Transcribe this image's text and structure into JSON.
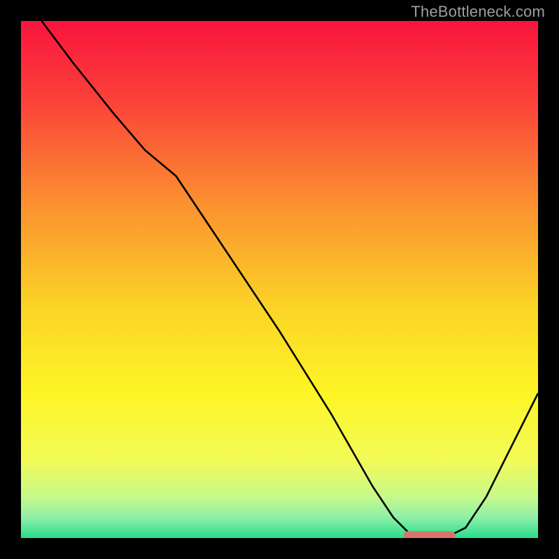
{
  "watermark": "TheBottleneck.com",
  "chart_data": {
    "type": "line",
    "title": "",
    "xlabel": "",
    "ylabel": "",
    "xlim": [
      0,
      100
    ],
    "ylim": [
      0,
      100
    ],
    "series": [
      {
        "name": "bottleneck-curve",
        "x": [
          4,
          10,
          18,
          24,
          30,
          40,
          50,
          60,
          68,
          72,
          75,
          78,
          82,
          86,
          90,
          94,
          100
        ],
        "y": [
          100,
          92,
          82,
          75,
          70,
          55,
          40,
          24,
          10,
          4,
          1,
          0,
          0,
          2,
          8,
          16,
          28
        ]
      }
    ],
    "segment": {
      "name": "highlight-segment",
      "x": [
        74,
        84
      ],
      "y": [
        0.5,
        0.5
      ],
      "color": "#d9746b"
    },
    "gradient_stops": [
      {
        "offset": 0.0,
        "color": "#f9143e"
      },
      {
        "offset": 0.15,
        "color": "#fb4039"
      },
      {
        "offset": 0.35,
        "color": "#fb8f30"
      },
      {
        "offset": 0.55,
        "color": "#fbd327"
      },
      {
        "offset": 0.72,
        "color": "#fdf525"
      },
      {
        "offset": 0.85,
        "color": "#f2fb58"
      },
      {
        "offset": 0.92,
        "color": "#c7f98b"
      },
      {
        "offset": 0.96,
        "color": "#8ef0a6"
      },
      {
        "offset": 1.0,
        "color": "#29dd8d"
      }
    ]
  }
}
